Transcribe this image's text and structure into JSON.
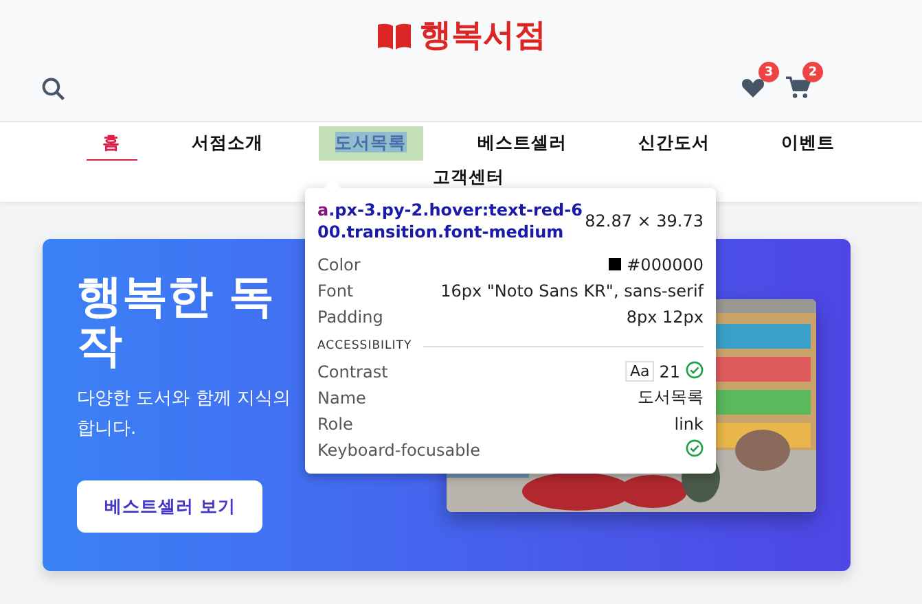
{
  "logo": {
    "text": "행복서점"
  },
  "header_icons": [
    {
      "kind": "heart",
      "badge": "3"
    },
    {
      "kind": "cart",
      "badge": "2"
    }
  ],
  "nav": [
    {
      "label": "홈",
      "selected": true,
      "highlighted": false
    },
    {
      "label": "서점소개",
      "selected": false,
      "highlighted": false
    },
    {
      "label": "도서목록",
      "selected": false,
      "highlighted": true
    },
    {
      "label": "베스트셀러",
      "selected": false,
      "highlighted": false
    },
    {
      "label": "신간도서",
      "selected": false,
      "highlighted": false
    },
    {
      "label": "이벤트",
      "selected": false,
      "highlighted": false
    },
    {
      "label": "고객센터",
      "selected": false,
      "highlighted": false
    }
  ],
  "hero": {
    "title_lines": [
      "행복한 독",
      "작"
    ],
    "subtitle_lines": [
      "다양한 도서와 함께 지식의",
      "합니다."
    ],
    "button": "베스트셀러 보기",
    "image": {
      "kind": "picture"
    }
  },
  "inspector": {
    "tag": "a",
    "classes": ".px-3.py-2.hover:text-red-600.transition.font-medium",
    "size": "82.87 × 39.73",
    "properties": [
      {
        "kind": "color",
        "label": "Color",
        "value": "#000000"
      },
      {
        "kind": "text",
        "label": "Font",
        "value": "16px \"Noto Sans KR\", sans-serif"
      },
      {
        "kind": "text",
        "label": "Padding",
        "value": "8px 12px"
      }
    ],
    "section": "ACCESSIBILITY",
    "accessibility": [
      {
        "kind": "contrast",
        "label": "Contrast",
        "sample": "Aa",
        "value": "21",
        "passed": true
      },
      {
        "kind": "text",
        "label": "Name",
        "value": "도서목록"
      },
      {
        "kind": "text",
        "label": "Role",
        "value": "link"
      },
      {
        "kind": "check",
        "label": "Keyboard-focusable",
        "passed": true
      }
    ]
  }
}
